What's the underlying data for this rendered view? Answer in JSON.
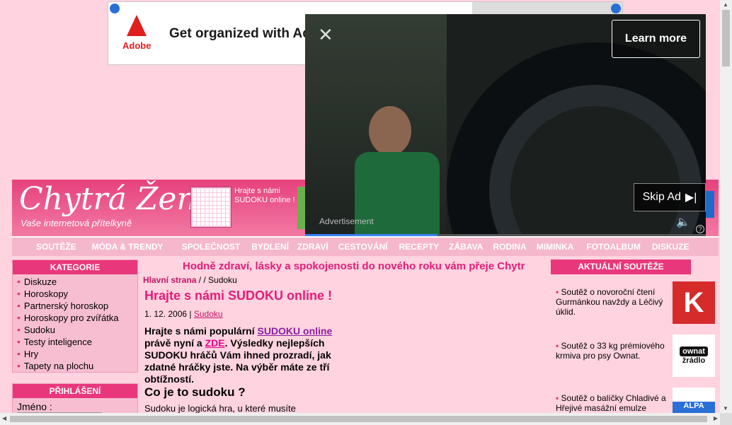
{
  "ad_banner": {
    "brand": "Adobe",
    "headline": "Get organized with Ac"
  },
  "video_ad": {
    "close": "✕",
    "learn_more": "Learn more",
    "skip": "Skip Ad",
    "skip_icon": "▶|",
    "label": "Advertisement",
    "volume_icon": "🔈",
    "help_icon": "?",
    "progress": 0.33
  },
  "header": {
    "site_name": "Chytrá Žena",
    "slogan": "Vaše   internetová přítelkyně",
    "promo_text": "Hrajte s námi SUDOKU online !"
  },
  "nav": [
    "SOUTĚŽE",
    "MÓDA & TRENDY",
    "SPOLEČNOST",
    "BYDLENÍ",
    "ZDRAVÍ",
    "CESTOVÁNÍ",
    "RECEPTY",
    "ZÁBAVA",
    "RODINA",
    "MIMINKA",
    "FOTOALBUM",
    "DISKUZE"
  ],
  "categories": {
    "title": "KATEGORIE",
    "items": [
      "Diskuze",
      "Horoskopy",
      "Partnerský horoskop",
      "Horoskopy pro zvířátka",
      "Sudoku",
      "Testy inteligence",
      "Hry",
      "Tapety na plochu"
    ]
  },
  "login": {
    "title": "PŘIHLÁŠENÍ",
    "name_label": "Jméno :"
  },
  "content": {
    "greeting": "Hodně zdraví, lásky a spokojenosti do nového roku vám přeje Chytr",
    "breadcrumb_home": "Hlavní strana",
    "breadcrumb_rest": " /  / Sudoku",
    "title": "Hrajte s námi SUDOKU online !",
    "date": "1. 12. 2006 |",
    "category": "Sudoku",
    "lead_1": "Hrajte s námi populární ",
    "lead_link": "SUDOKU online",
    "lead_2": " právě nyní a ",
    "lead_zde": "ZDE",
    "lead_3": ". Výsledky nejlepších SUDOKU hráčů Vám ihned prozradí, jak zdatné hráčky jste. Na výběr máte ze tří obtížností.",
    "subhead": "Co je to sudoku ?",
    "body": "Sudoku je logická hra, u které musíte"
  },
  "competitions": {
    "title": "AKTUÁLNÍ SOUTĚŽE",
    "items": [
      {
        "text": "Soutěž o novoroční čtení Gurmánkou navždy a Léčivý úklid."
      },
      {
        "text": "Soutěž o 33 kg prémiového krmiva pro psy Ownat."
      },
      {
        "text": "Soutěž o balíčky Chladivé a Hřejivé masážní emulze"
      }
    ],
    "ownat_logo_top": "ownat",
    "ownat_logo_bottom": "žrádlo",
    "alpa_logo": "ALPA"
  }
}
